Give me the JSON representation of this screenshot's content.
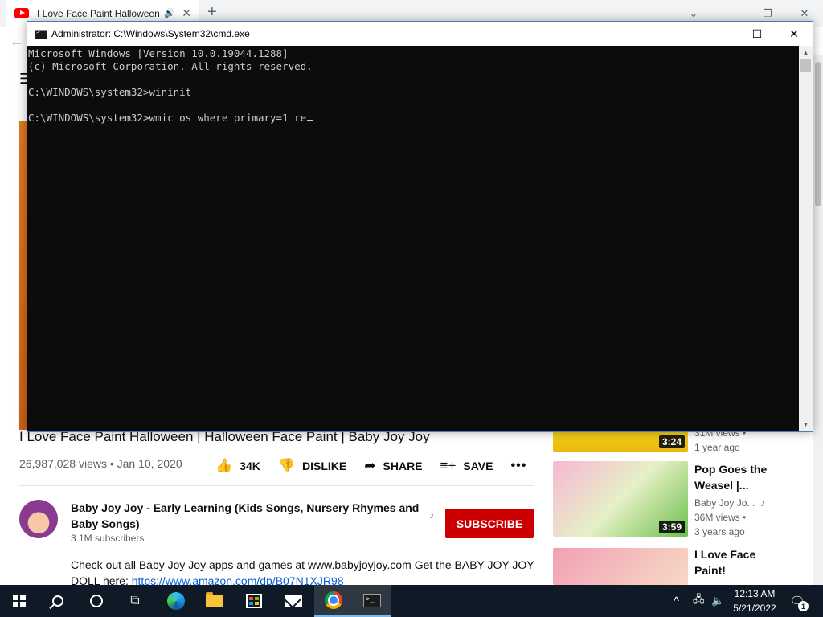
{
  "browser": {
    "tab_title": "I Love Face Paint Halloween | Halloween Face Paint | Baby Joy Joy",
    "new_tab_glyph": "+",
    "tab_close_glyph": "✕",
    "audio_glyph": "🔊",
    "back_glyph": "←",
    "window_controls": [
      "⌄",
      "—",
      "❐",
      "✕"
    ]
  },
  "youtube": {
    "menu_glyph": "☰",
    "video_title": "I Love Face Paint Halloween | Halloween Face Paint | Baby Joy Joy",
    "views_date": "26,987,028 views • Jan 10, 2020",
    "like_count": "34K",
    "dislike_label": "DISLIKE",
    "share_label": "SHARE",
    "save_label": "SAVE",
    "more_glyph": "•••",
    "channel_name": "Baby Joy Joy - Early Learning (Kids Songs, Nursery Rhymes and Baby Songs)",
    "subscribers": "3.1M subscribers",
    "subscribe_label": "SUBSCRIBE",
    "description": "Check out all Baby Joy Joy apps and games at www.babyjoyjoy.com Get the BABY JOY JOY DOLL here:",
    "description_link": "https://www.amazon.com/dp/B07N1XJR98",
    "recommendations": [
      {
        "duration": "3:24",
        "views": "31M views •",
        "age": "1 year ago"
      },
      {
        "duration": "3:59",
        "title_line1": "Pop Goes the",
        "title_line2": "Weasel |...",
        "channel": "Baby Joy Jo...",
        "views": "36M views •",
        "age": "3 years ago"
      },
      {
        "title_line1": "I Love Face",
        "title_line2": "Paint!"
      }
    ]
  },
  "cmd": {
    "window_title": "Administrator: C:\\Windows\\System32\\cmd.exe",
    "controls": [
      "—",
      "☐",
      "✕"
    ],
    "lines": [
      "Microsoft Windows [Version 10.0.19044.1288]",
      "(c) Microsoft Corporation. All rights reserved.",
      "",
      "C:\\WINDOWS\\system32>wininit",
      "",
      "C:\\WINDOWS\\system32>wmic os where primary=1 re"
    ]
  },
  "taskbar": {
    "tray_chevron": "^",
    "tray_network": "🖧",
    "tray_volume": "🔈",
    "time": "12:13 AM",
    "date": "5/21/2022",
    "notification_count": "1",
    "notification_glyph": "🗨"
  }
}
